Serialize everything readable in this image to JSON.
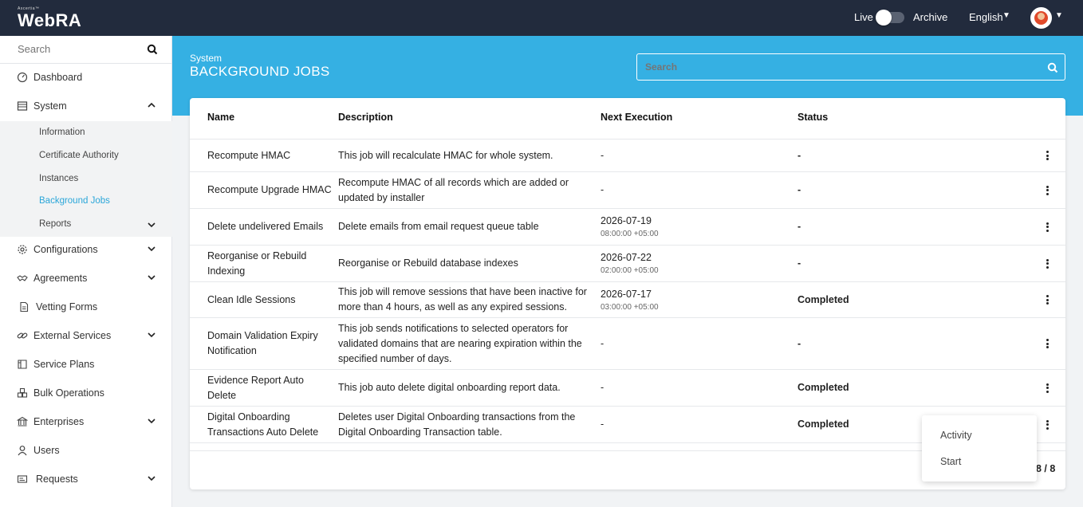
{
  "app": {
    "brand_small": "Ascertia™",
    "brand": "WebRA"
  },
  "topbar": {
    "live_label": "Live",
    "archive_label": "Archive",
    "language": "English"
  },
  "sidebar": {
    "search_placeholder": "Search",
    "items": [
      {
        "label": "Dashboard",
        "icon": "dashboard-icon"
      },
      {
        "label": "System",
        "icon": "system-icon",
        "expanded": true
      },
      {
        "label": "Configurations",
        "icon": "gear-icon"
      },
      {
        "label": "Agreements",
        "icon": "handshake-icon"
      },
      {
        "label": "Vetting Forms",
        "icon": "document-icon"
      },
      {
        "label": "External Services",
        "icon": "link-icon"
      },
      {
        "label": "Service Plans",
        "icon": "service-plans-icon"
      },
      {
        "label": "Bulk Operations",
        "icon": "bulk-icon"
      },
      {
        "label": "Enterprises",
        "icon": "bank-icon"
      },
      {
        "label": "Users",
        "icon": "user-icon"
      },
      {
        "label": "Requests",
        "icon": "requests-icon"
      }
    ],
    "system_sub": [
      {
        "label": "Information"
      },
      {
        "label": "Certificate Authority"
      },
      {
        "label": "Instances"
      },
      {
        "label": "Background Jobs",
        "active": true
      },
      {
        "label": "Reports"
      }
    ]
  },
  "page": {
    "breadcrumb": "System",
    "title": "BACKGROUND JOBS",
    "search_placeholder": "Search"
  },
  "table": {
    "headers": {
      "name": "Name",
      "description": "Description",
      "next": "Next Execution",
      "status": "Status"
    },
    "rows": [
      {
        "name": "Recompute HMAC",
        "description": "This job will recalculate HMAC for whole system.",
        "next_date": "-",
        "next_time": "",
        "status": "-"
      },
      {
        "name": "Recompute Upgrade HMAC",
        "description": "Recompute HMAC of all records which are added or updated by installer",
        "next_date": "-",
        "next_time": "",
        "status": "-"
      },
      {
        "name": "Delete undelivered Emails",
        "description": "Delete emails from email request queue table",
        "next_date": "2026-07-19",
        "next_time": "08:00:00 +05:00",
        "status": "-"
      },
      {
        "name": "Reorganise or Rebuild Indexing",
        "description": "Reorganise or Rebuild database indexes",
        "next_date": "2026-07-22",
        "next_time": "02:00:00 +05:00",
        "status": "-"
      },
      {
        "name": "Clean Idle Sessions",
        "description": "This job will remove sessions that have been inactive for more than 4 hours, as well as any expired sessions.",
        "next_date": "2026-07-17",
        "next_time": "03:00:00 +05:00",
        "status": "Completed"
      },
      {
        "name": "Domain Validation Expiry Notification",
        "description": "This job sends notifications to selected operators for validated domains that are nearing expiration within the specified number of days.",
        "next_date": "-",
        "next_time": "",
        "status": "-"
      },
      {
        "name": "Evidence Report Auto Delete",
        "description": "This job auto delete digital onboarding report data.",
        "next_date": "-",
        "next_time": "",
        "status": "Completed"
      },
      {
        "name": "Digital Onboarding Transactions Auto Delete",
        "description": "Deletes user Digital Onboarding transactions from the Digital Onboarding Transaction table.",
        "next_date": "-",
        "next_time": "",
        "status": "Completed"
      }
    ]
  },
  "pager": {
    "text": "8 / 8"
  },
  "row_menu": {
    "items": [
      "Activity",
      "Start"
    ]
  }
}
